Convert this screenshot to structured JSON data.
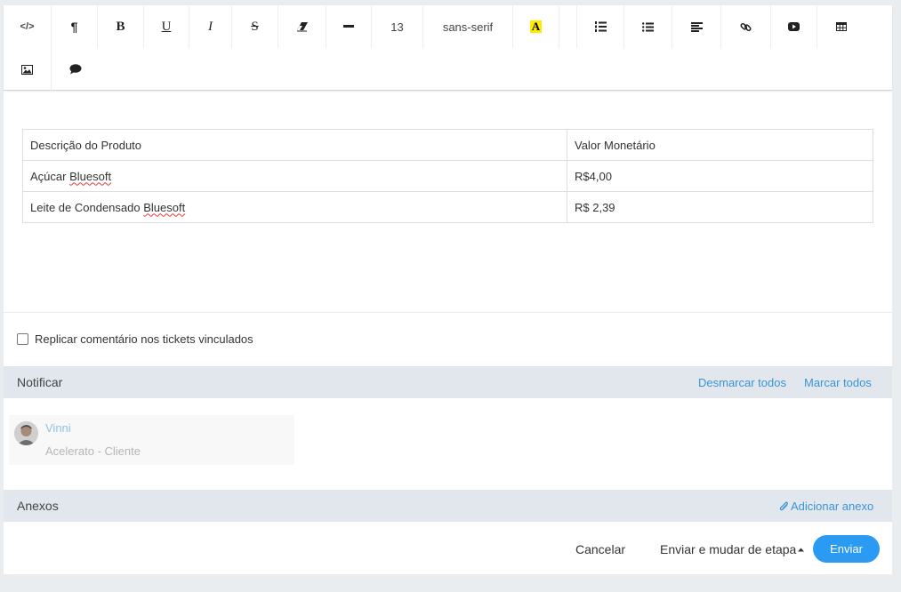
{
  "toolbar": {
    "font_size": "13",
    "font_family": "sans-serif",
    "highlight_glyph": "A",
    "bold_glyph": "B",
    "underline_glyph": "U",
    "italic_glyph": "I",
    "strike_glyph": "S",
    "pilcrow_glyph": "¶",
    "code_glyph": "</>",
    "icons": [
      "code-view-icon",
      "paragraph-icon",
      "bold-icon",
      "underline-icon",
      "italic-icon",
      "strikethrough-icon",
      "eraser-icon",
      "horizontal-rule-icon",
      "font-size-select",
      "font-family-select",
      "highlight-color-icon",
      "ordered-list-icon",
      "unordered-list-icon",
      "align-left-icon",
      "link-icon",
      "video-icon",
      "table-icon",
      "image-icon",
      "comment-icon"
    ]
  },
  "editor": {
    "table": {
      "header": [
        "Descrição do Produto",
        "Valor Monetário"
      ],
      "rows": [
        {
          "product_prefix": "Açúcar ",
          "product_brand": "Bluesoft",
          "value": "R$4,00"
        },
        {
          "product_prefix": "Leite de Condensado ",
          "product_brand": "Bluesoft",
          "value": "R$ 2,39"
        }
      ]
    }
  },
  "replicate_label": "Replicar comentário nos tickets vinculados",
  "notify": {
    "title": "Notificar",
    "uncheck_all": "Desmarcar todos",
    "check_all": "Marcar todos",
    "user": {
      "name": "Vinni",
      "role": "Acelerato - Cliente"
    }
  },
  "attachments": {
    "title": "Anexos",
    "add_label": "Adicionar anexo"
  },
  "footer": {
    "cancel": "Cancelar",
    "send_and_change": "Enviar e mudar de etapa",
    "send": "Enviar"
  },
  "colors": {
    "link": "#3a95d8",
    "primary_button": "#2b9af3",
    "section_header": "#e1e7ec",
    "background": "#e9edef",
    "highlight": "#ffeb00"
  }
}
